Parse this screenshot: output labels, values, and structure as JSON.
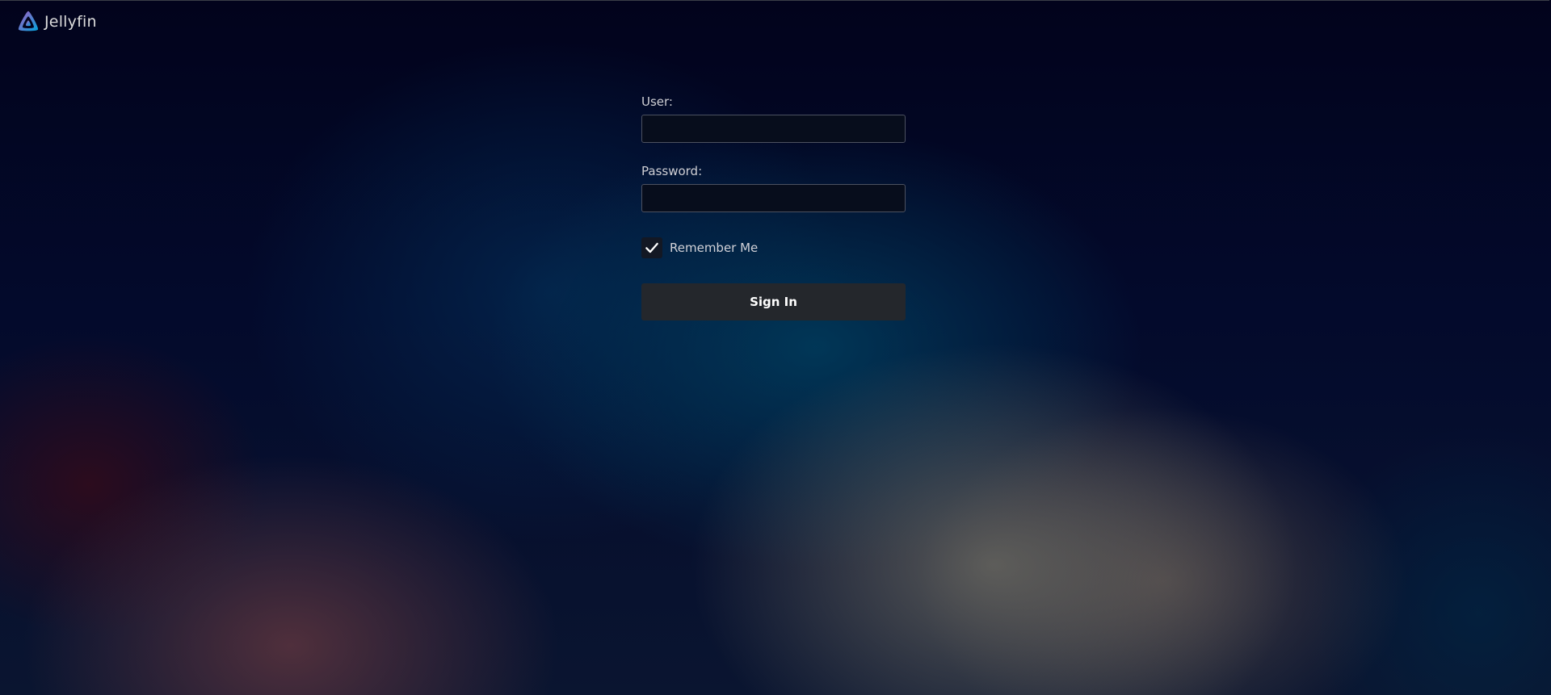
{
  "app": {
    "name": "Jellyfin",
    "logo_icon": "jellyfin-logo-icon"
  },
  "colors": {
    "logo_gradient_start": "#aa5cc3",
    "logo_gradient_end": "#00a4dc",
    "button_background": "#24272c",
    "input_background": "#070d1c"
  },
  "login": {
    "user_label": "User:",
    "user_value": "",
    "password_label": "Password:",
    "password_value": "",
    "remember_me_label": "Remember Me",
    "remember_me_checked": true,
    "sign_in_label": "Sign In"
  }
}
